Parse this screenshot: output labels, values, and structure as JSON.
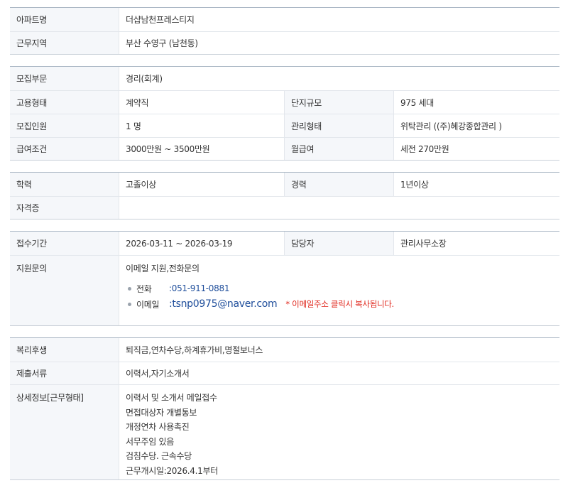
{
  "basic": {
    "apartment_label": "아파트명",
    "apartment_value": "더샵남천프레스티지",
    "location_label": "근무지역",
    "location_value": "부산 수영구 (남천동)"
  },
  "recruit": {
    "field_label": "모집부문",
    "field_value": "경리(회계)",
    "employment_label": "고용형태",
    "employment_value": "계약직",
    "complex_size_label": "단지규모",
    "complex_size_value": "975 세대",
    "headcount_label": "모집인원",
    "headcount_value": "1 명",
    "management_label": "관리형태",
    "management_value": "위탁관리 ((주)혜강종합관리 )",
    "salary_label": "급여조건",
    "salary_value": "3000만원 ~ 3500만원",
    "monthly_label": "월급여",
    "monthly_value": "세전 270만원"
  },
  "qualification": {
    "education_label": "학력",
    "education_value": "고졸이상",
    "experience_label": "경력",
    "experience_value": "1년이상",
    "license_label": "자격증",
    "license_value": ""
  },
  "application": {
    "period_label": "접수기간",
    "period_value": "2026-03-11 ~ 2026-03-19",
    "manager_label": "담당자",
    "manager_value": "관리사무소장",
    "inquiry_label": "지원문의",
    "inquiry_methods": "이메일 지원,전화문의",
    "phone_label": "전화",
    "phone_value": ":051-911-0881",
    "email_label": "이메일",
    "email_value": ":tsnp0975@naver.com",
    "email_note": "* 이메일주소 클릭시 복사됩니다."
  },
  "extra": {
    "benefits_label": "복리후생",
    "benefits_value": "퇴직금,연차수당,하계휴가비,명절보너스",
    "documents_label": "제출서류",
    "documents_value": "이력서,자기소개서",
    "details_label": "상세정보[근무형태]",
    "details_lines": [
      "이력서 및 소개서 메일접수",
      "면접대상자 개별통보",
      "개정연차 사용촉진",
      "서무주임 있음",
      "검침수당. 근속수당",
      "근무개시일:2026.4.1부터"
    ]
  },
  "colors": {
    "header_bg": "#f5f7fa",
    "top_border": "#a7b4c2",
    "link_blue": "#1f4e9b",
    "note_red": "#e0261b"
  }
}
